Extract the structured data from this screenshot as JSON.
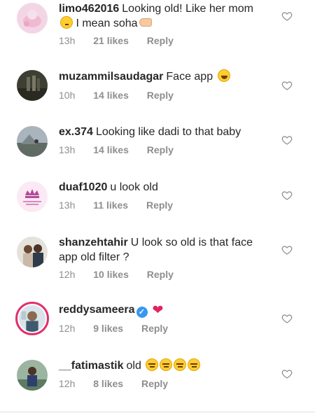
{
  "comments": [
    {
      "username": "limo462016",
      "text": "Looking old! Like her mom",
      "text2": "I mean soha",
      "time": "13h",
      "likes": "21 likes",
      "reply": "Reply"
    },
    {
      "username": "muzammilsaudagar",
      "text": "Face app",
      "time": "10h",
      "likes": "14 likes",
      "reply": "Reply"
    },
    {
      "username": "ex.374",
      "text": "Looking like dadi to that baby",
      "time": "13h",
      "likes": "14 likes",
      "reply": "Reply"
    },
    {
      "username": "duaf1020",
      "text": "u look old",
      "time": "13h",
      "likes": "11 likes",
      "reply": "Reply"
    },
    {
      "username": "shanzehtahir",
      "text": "U look so old is that face",
      "text2": "app old filter ?",
      "time": "12h",
      "likes": "10 likes",
      "reply": "Reply"
    },
    {
      "username": "reddysameera",
      "text": "",
      "time": "12h",
      "likes": "9 likes",
      "reply": "Reply"
    },
    {
      "username": "__fatimastik",
      "text": "old",
      "time": "12h",
      "likes": "8 likes",
      "reply": "Reply"
    }
  ],
  "icons": {
    "like": "heart-outline-icon",
    "verified": "verified-badge-icon"
  },
  "colors": {
    "text": "#262626",
    "meta": "#8e8e8e",
    "verified": "#3897f0",
    "story_ring": "#e1306c"
  }
}
